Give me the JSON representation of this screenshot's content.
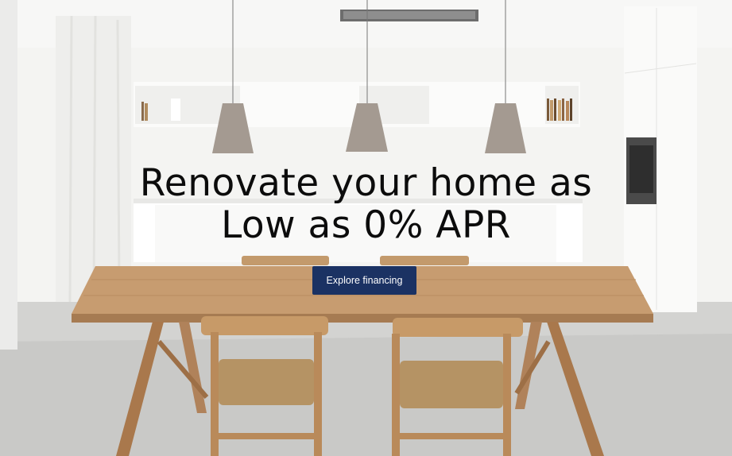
{
  "hero": {
    "headline_line1": "Renovate your home as",
    "headline_line2": "Low as 0% APR",
    "cta_label": "Explore financing",
    "cta_color": "#1b3263",
    "image_subject": "modern-white-kitchen-with-wooden-dining-table"
  }
}
